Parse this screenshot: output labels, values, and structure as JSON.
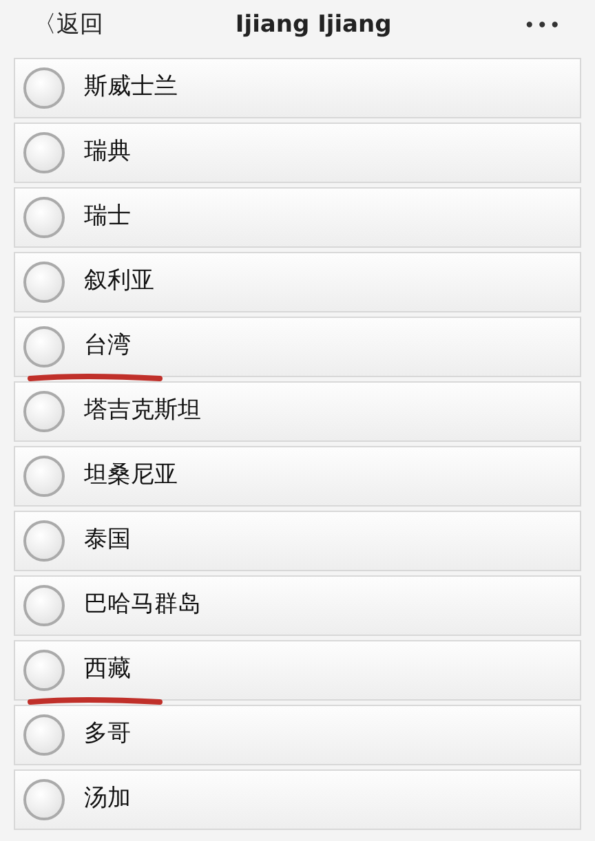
{
  "header": {
    "back_icon": "〈",
    "back": "返回",
    "title": "Ijiang Ijiang",
    "more": "•••"
  },
  "options": [
    {
      "label": "斯威士兰",
      "selected": false,
      "underlined": false
    },
    {
      "label": "瑞典",
      "selected": false,
      "underlined": false
    },
    {
      "label": "瑞士",
      "selected": false,
      "underlined": false
    },
    {
      "label": "叙利亚",
      "selected": false,
      "underlined": false
    },
    {
      "label": "台湾",
      "selected": false,
      "underlined": true
    },
    {
      "label": "塔吉克斯坦",
      "selected": false,
      "underlined": false
    },
    {
      "label": "坦桑尼亚",
      "selected": false,
      "underlined": false
    },
    {
      "label": "泰国",
      "selected": false,
      "underlined": false
    },
    {
      "label": "巴哈马群岛",
      "selected": false,
      "underlined": false
    },
    {
      "label": "西藏",
      "selected": false,
      "underlined": true
    },
    {
      "label": "多哥",
      "selected": false,
      "underlined": false
    },
    {
      "label": "汤加",
      "selected": false,
      "underlined": false
    }
  ]
}
